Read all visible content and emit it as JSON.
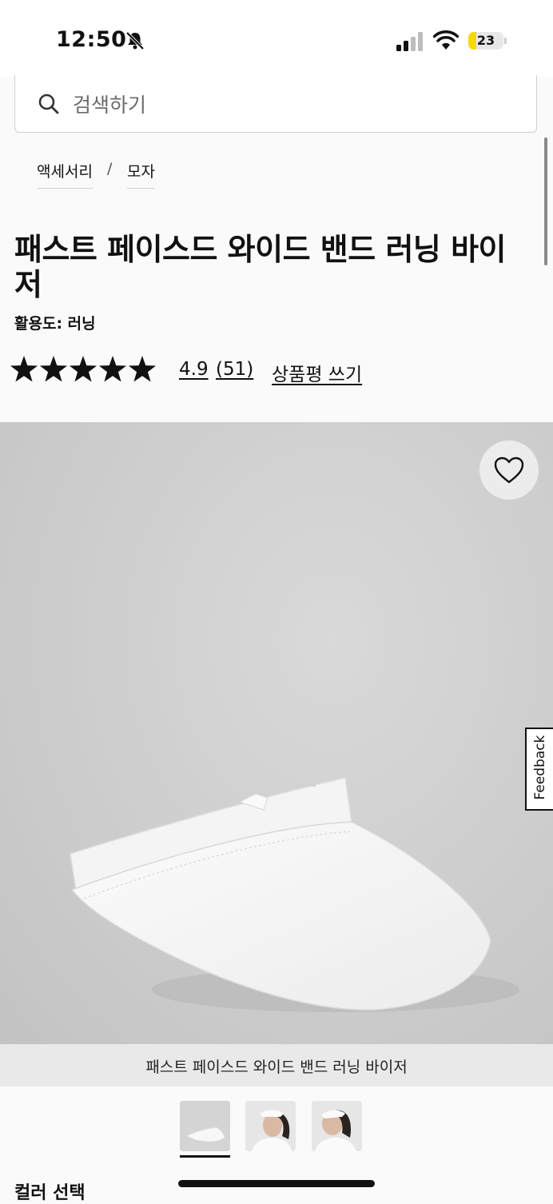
{
  "status_bar": {
    "time": "12:50",
    "battery": "23",
    "battery_level": 0.23,
    "silent_icon": "bell-slash-icon"
  },
  "search": {
    "placeholder": "검색하기"
  },
  "breadcrumb": {
    "items": [
      "액세서리",
      "모자"
    ],
    "separator": "/"
  },
  "product": {
    "title": "패스트 페이스드 와이드 밴드 러닝 바이저",
    "activity": "활용도: 러닝",
    "rating": "4.9",
    "rating_stars": 5,
    "review_count": "(51)",
    "write_review": "상품평 쓰기",
    "image_caption": "패스트 페이스드 와이드 밴드 러닝 바이저"
  },
  "feedback": {
    "label": "Feedback"
  },
  "color_section": {
    "label": "컬러 선택"
  },
  "colors": {
    "accent": "#111111",
    "battery": "#f5d90a",
    "image_bg": "#cfcfcf"
  }
}
